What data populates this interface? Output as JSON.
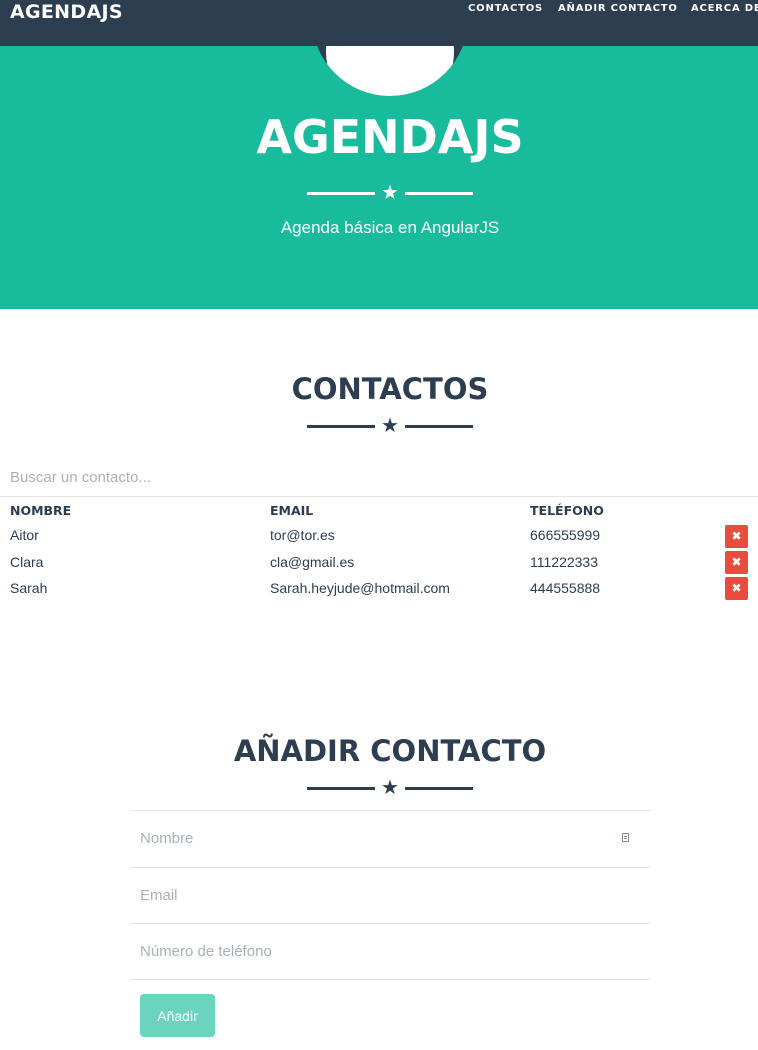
{
  "navbar": {
    "brand": "AGENDAJS",
    "links": [
      "CONTACTOS",
      "AÑADIR CONTACTO",
      "ACERCA DE"
    ]
  },
  "hero": {
    "title": "AGENDAJS",
    "subtitle": "Agenda básica en AngularJS"
  },
  "contacts_section": {
    "title": "CONTACTOS",
    "search_placeholder": "Buscar un contacto...",
    "columns": [
      "NOMBRE",
      "EMAIL",
      "TELÉFONO"
    ],
    "delete_icon": "✖",
    "rows": [
      {
        "name": "Aitor",
        "email": "tor@tor.es",
        "phone": "666555999"
      },
      {
        "name": "Clara",
        "email": "cla@gmail.es",
        "phone": "111222333"
      },
      {
        "name": "Sarah",
        "email": "Sarah.heyjude@hotmail.com",
        "phone": "444555888"
      }
    ]
  },
  "add_section": {
    "title": "AÑADIR CONTACTO",
    "name_placeholder": "Nombre",
    "email_placeholder": "Email",
    "phone_placeholder": "Número de teléfono",
    "submit_label": "Añadir"
  },
  "colors": {
    "navbar": "#2c3e50",
    "hero": "#18bc9c",
    "danger": "#e74c3c",
    "button": "#6ad4bf"
  }
}
